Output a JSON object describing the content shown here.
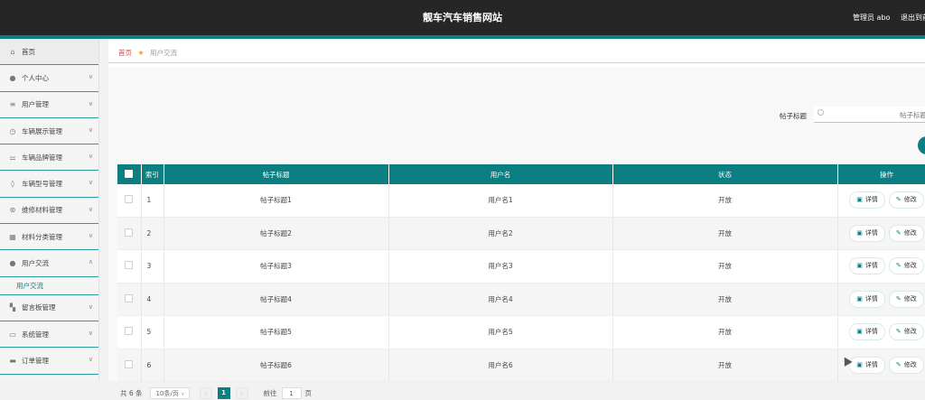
{
  "header": {
    "title": "靓车汽车销售网站",
    "admin_label": "管理员 abo",
    "logout_label": "退出到前"
  },
  "sidebar": {
    "items": [
      {
        "label": "首页",
        "icon": "home-icon"
      },
      {
        "label": "个人中心",
        "icon": "user-icon"
      },
      {
        "label": "用户管理",
        "icon": "list-icon"
      },
      {
        "label": "车辆展示管理",
        "icon": "clock-icon"
      },
      {
        "label": "车辆品牌管理",
        "icon": "sliders-icon"
      },
      {
        "label": "车辆型号管理",
        "icon": "tag-icon"
      },
      {
        "label": "维修材料管理",
        "icon": "lifebuoy-icon"
      },
      {
        "label": "材料分类管理",
        "icon": "grid-icon"
      },
      {
        "label": "用户交流",
        "icon": "user-icon"
      },
      {
        "label": "留言板管理",
        "icon": "apps-icon"
      },
      {
        "label": "系统管理",
        "icon": "card-icon"
      },
      {
        "label": "订单管理",
        "icon": "order-icon"
      }
    ],
    "submenu": {
      "label": "用户交流"
    }
  },
  "breadcrumb": {
    "home": "首页",
    "current": "用户交流"
  },
  "search": {
    "label": "帖子标题",
    "placeholder": "帖子标题"
  },
  "table": {
    "headers": [
      "索引",
      "帖子标题",
      "用户名",
      "状态",
      "操作"
    ],
    "rows": [
      {
        "idx": "1",
        "title": "帖子标题1",
        "user": "用户名1",
        "status": "开放"
      },
      {
        "idx": "2",
        "title": "帖子标题2",
        "user": "用户名2",
        "status": "开放"
      },
      {
        "idx": "3",
        "title": "帖子标题3",
        "user": "用户名3",
        "status": "开放"
      },
      {
        "idx": "4",
        "title": "帖子标题4",
        "user": "用户名4",
        "status": "开放"
      },
      {
        "idx": "5",
        "title": "帖子标题5",
        "user": "用户名5",
        "status": "开放"
      },
      {
        "idx": "6",
        "title": "帖子标题6",
        "user": "用户名6",
        "status": "开放"
      }
    ],
    "actions": {
      "detail": "详情",
      "edit": "修改"
    }
  },
  "pagination": {
    "total": "共 6 条",
    "page_size": "10条/页",
    "current_page": "1",
    "goto_label": "前往",
    "goto_value": "1",
    "page_unit": "页"
  },
  "colors": {
    "accent": "#0b7f82",
    "topbar": "#262626",
    "breadcrumb_home": "#e04444"
  }
}
